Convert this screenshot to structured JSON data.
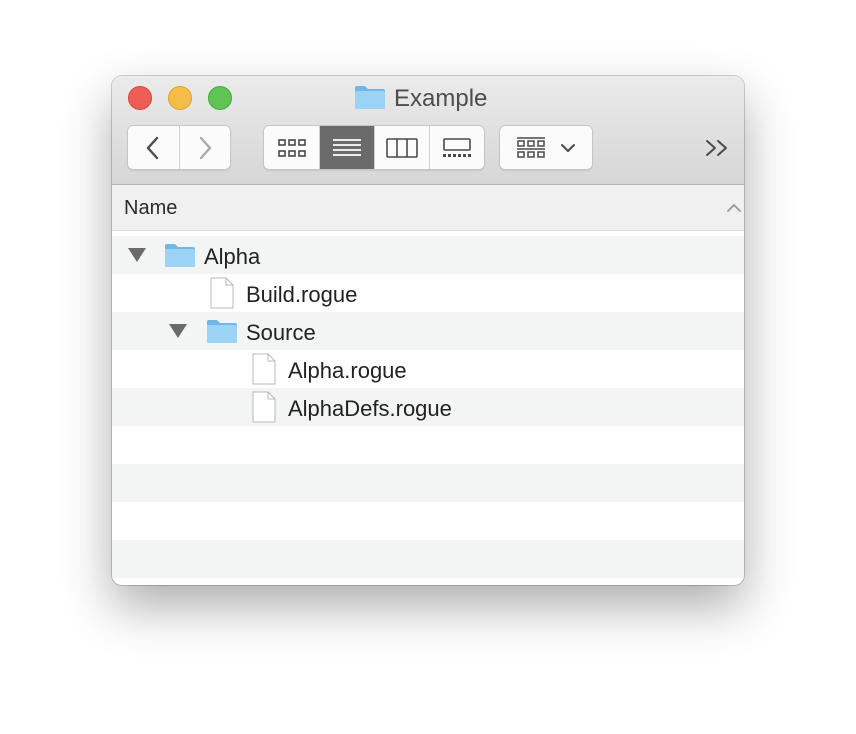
{
  "window": {
    "title": "Example"
  },
  "toolbar": {
    "back_icon": "chevron-left-icon",
    "forward_icon": "chevron-right-icon",
    "view_modes": [
      {
        "name": "icon-view",
        "icon": "grid-icon",
        "active": false
      },
      {
        "name": "list-view",
        "icon": "list-icon",
        "active": true
      },
      {
        "name": "column-view",
        "icon": "columns-icon",
        "active": false
      },
      {
        "name": "gallery-view",
        "icon": "gallery-icon",
        "active": false
      }
    ],
    "arrange_icon": "arrange-group-icon",
    "overflow_label": ">>"
  },
  "list": {
    "column_header": "Name",
    "sort_direction": "ascending",
    "items": [
      {
        "label": "Alpha",
        "type": "folder",
        "depth": 0,
        "expanded": true
      },
      {
        "label": "Build.rogue",
        "type": "file",
        "depth": 1
      },
      {
        "label": "Source",
        "type": "folder",
        "depth": 1,
        "expanded": true
      },
      {
        "label": "Alpha.rogue",
        "type": "file",
        "depth": 2
      },
      {
        "label": "AlphaDefs.rogue",
        "type": "file",
        "depth": 2
      }
    ]
  },
  "colors": {
    "close": "#ee5e55",
    "minimize": "#f5bd48",
    "maximize": "#5fc454",
    "folder": "#8ccaf0",
    "active_view": "#6b6b6b",
    "row_stripe": "#f3f4f4"
  }
}
